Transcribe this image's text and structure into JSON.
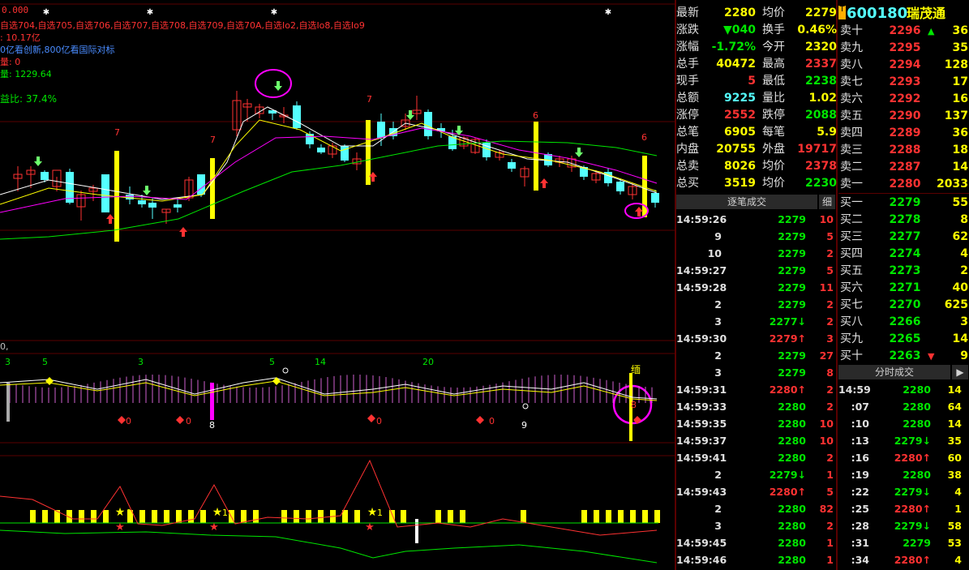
{
  "chart": {
    "y_axis_value": "0.000",
    "watchlist_line": "自选704,自选705,自选706,自选707,自选708,自选709,自选70A,自选Io2,自选Io8,自选Io9",
    "info_line2": ": 10.17亿",
    "info_line3": "0亿看创新,800亿看国际对标",
    "info_line4": "量: 0",
    "info_line5": "量: 1229.64",
    "ratio_label": "益比: 37.4%",
    "panel2_prefix": "0,",
    "panel2_numbers": [
      "3",
      "5",
      "3",
      "5",
      "14",
      "20"
    ],
    "panel2_markers": [
      "0",
      "0",
      "8",
      "0",
      "0",
      "9",
      "8"
    ],
    "candle_markers": [
      "7",
      "7",
      "7",
      "6",
      "6"
    ],
    "sig_label": "缅",
    "panel3_labels": [
      "1",
      "1",
      "1"
    ]
  },
  "quote": {
    "stock_code": "600180",
    "stock_name": "瑞茂通",
    "badge": "T",
    "rows": [
      {
        "l1": "最新",
        "v1": "2280",
        "l2": "均价",
        "v2": "2279"
      },
      {
        "l1": "涨跌",
        "v1": "▼040",
        "l2": "换手",
        "v2": "0.46%"
      },
      {
        "l1": "涨幅",
        "v1": "-1.72%",
        "l2": "今开",
        "v2": "2320"
      },
      {
        "l1": "总手",
        "v1": "40472",
        "l2": "最高",
        "v2": "2337"
      },
      {
        "l1": "现手",
        "v1": "5",
        "l2": "最低",
        "v2": "2238"
      },
      {
        "l1": "总额",
        "v1": "9225",
        "l2": "量比",
        "v2": "1.02"
      },
      {
        "l1": "涨停",
        "v1": "2552",
        "l2": "跌停",
        "v2": "2088"
      },
      {
        "l1": "总笔",
        "v1": "6905",
        "l2": "每笔",
        "v2": "5.9"
      },
      {
        "l1": "内盘",
        "v1": "20755",
        "l2": "外盘",
        "v2": "19717"
      },
      {
        "l1": "总卖",
        "v1": "8026",
        "l2": "均价",
        "v2": "2378"
      },
      {
        "l1": "总买",
        "v1": "3519",
        "l2": "均价",
        "v2": "2230"
      }
    ]
  },
  "tick_header": {
    "title": "逐笔成交",
    "detail": "细"
  },
  "ticks": [
    {
      "t": "14:59:26",
      "p": "2279",
      "v": "10"
    },
    {
      "t": "9",
      "p": "2279",
      "v": "5"
    },
    {
      "t": "10",
      "p": "2279",
      "v": "2"
    },
    {
      "t": "14:59:27",
      "p": "2279",
      "v": "5"
    },
    {
      "t": "14:59:28",
      "p": "2279",
      "v": "11"
    },
    {
      "t": "2",
      "p": "2279",
      "v": "2"
    },
    {
      "t": "3",
      "p": "2277↓",
      "v": "2"
    },
    {
      "t": "14:59:30",
      "p": "2279↑",
      "v": "3"
    },
    {
      "t": "2",
      "p": "2279",
      "v": "27"
    },
    {
      "t": "3",
      "p": "2279",
      "v": "8"
    },
    {
      "t": "14:59:31",
      "p": "2280↑",
      "v": "2"
    },
    {
      "t": "14:59:33",
      "p": "2280",
      "v": "2"
    },
    {
      "t": "14:59:35",
      "p": "2280",
      "v": "10"
    },
    {
      "t": "14:59:37",
      "p": "2280",
      "v": "10"
    },
    {
      "t": "14:59:41",
      "p": "2280",
      "v": "2"
    },
    {
      "t": "2",
      "p": "2279↓",
      "v": "1"
    },
    {
      "t": "14:59:43",
      "p": "2280↑",
      "v": "5"
    },
    {
      "t": "2",
      "p": "2280",
      "v": "82"
    },
    {
      "t": "3",
      "p": "2280",
      "v": "2"
    },
    {
      "t": "14:59:45",
      "p": "2280",
      "v": "1"
    },
    {
      "t": "14:59:46",
      "p": "2280",
      "v": "1"
    }
  ],
  "book": {
    "asks": [
      {
        "l": "卖十",
        "p": "2296",
        "q": "36",
        "mark": "▲"
      },
      {
        "l": "卖九",
        "p": "2295",
        "q": "35"
      },
      {
        "l": "卖八",
        "p": "2294",
        "q": "128"
      },
      {
        "l": "卖七",
        "p": "2293",
        "q": "17"
      },
      {
        "l": "卖六",
        "p": "2292",
        "q": "16"
      },
      {
        "l": "卖五",
        "p": "2290",
        "q": "137"
      },
      {
        "l": "卖四",
        "p": "2289",
        "q": "36"
      },
      {
        "l": "卖三",
        "p": "2288",
        "q": "18"
      },
      {
        "l": "卖二",
        "p": "2287",
        "q": "14"
      },
      {
        "l": "卖一",
        "p": "2280",
        "q": "2033"
      }
    ],
    "bids": [
      {
        "l": "买一",
        "p": "2279",
        "q": "55"
      },
      {
        "l": "买二",
        "p": "2278",
        "q": "8"
      },
      {
        "l": "买三",
        "p": "2277",
        "q": "62"
      },
      {
        "l": "买四",
        "p": "2274",
        "q": "4"
      },
      {
        "l": "买五",
        "p": "2273",
        "q": "2"
      },
      {
        "l": "买六",
        "p": "2271",
        "q": "40"
      },
      {
        "l": "买七",
        "p": "2270",
        "q": "625"
      },
      {
        "l": "买八",
        "p": "2266",
        "q": "3"
      },
      {
        "l": "买九",
        "p": "2265",
        "q": "14"
      },
      {
        "l": "买十",
        "p": "2263",
        "q": "9",
        "mark": "▼"
      }
    ]
  },
  "side_header": {
    "title": "分时成交",
    "arrow": "▶"
  },
  "side_ticks": [
    {
      "t": "14:59",
      "p": "2280",
      "v": "14"
    },
    {
      "t": ":07",
      "p": "2280",
      "v": "64"
    },
    {
      "t": ":10",
      "p": "2280",
      "v": "14"
    },
    {
      "t": ":13",
      "p": "2279↓",
      "v": "35"
    },
    {
      "t": ":16",
      "p": "2280↑",
      "v": "60"
    },
    {
      "t": ":19",
      "p": "2280",
      "v": "38"
    },
    {
      "t": ":22",
      "p": "2279↓",
      "v": "4"
    },
    {
      "t": ":25",
      "p": "2280↑",
      "v": "1"
    },
    {
      "t": ":28",
      "p": "2279↓",
      "v": "58"
    },
    {
      "t": ":31",
      "p": "2279",
      "v": "53"
    },
    {
      "t": ":34",
      "p": "2280↑",
      "v": "4"
    }
  ],
  "colors": {
    "up": "#ff3232",
    "down": "#00e600",
    "cyan": "#54ffff",
    "yellow": "#ffff00",
    "magenta": "#ff00ff",
    "grid": "#5a0000"
  }
}
